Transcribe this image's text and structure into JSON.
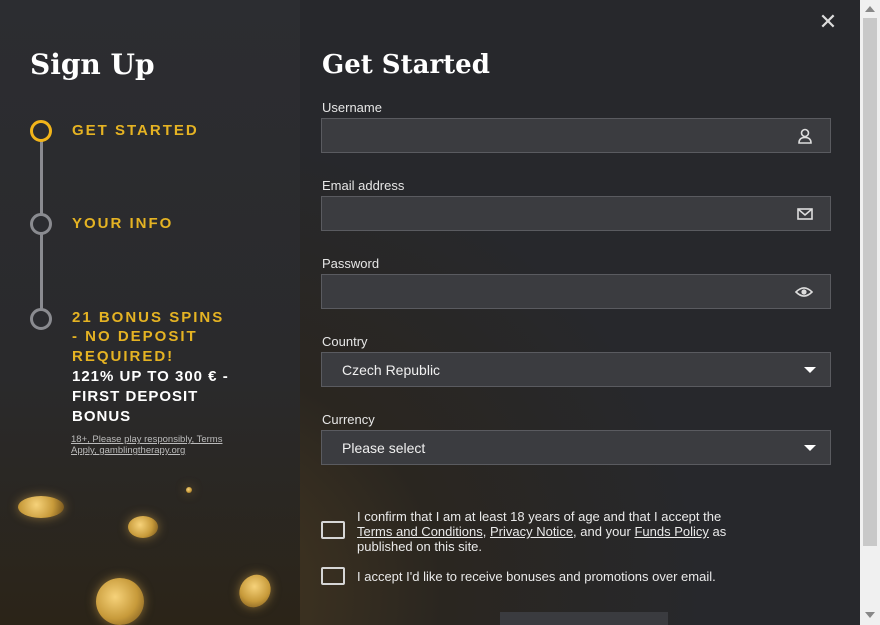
{
  "sidebar": {
    "title": "Sign Up",
    "steps": [
      {
        "label": "GET STARTED",
        "active": true
      },
      {
        "label": "YOUR INFO",
        "active": false
      },
      {
        "label": "21 BONUS SPINS - NO DEPOSIT REQUIRED!",
        "active": false
      }
    ],
    "bonus_lines": [
      "121% UP TO 300 € -",
      "FIRST DEPOSIT",
      "BONUS"
    ],
    "fine_print_lines": [
      "18+, Please play responsibly, Terms",
      "Apply, gamblingtherapy.org"
    ],
    "step3_lines": [
      "21 BONUS SPINS",
      "- NO DEPOSIT",
      "REQUIRED!"
    ]
  },
  "form": {
    "title": "Get Started",
    "username_label": "Username",
    "email_label": "Email address",
    "password_label": "Password",
    "country_label": "Country",
    "country_value": "Czech Republic",
    "currency_label": "Currency",
    "currency_value": "Please select",
    "icons": {
      "username": "user-icon",
      "email": "envelope-icon",
      "password": "eye-icon"
    }
  },
  "consent": {
    "age_text_1": "I confirm that I am at least 18 years of age and that I accept the",
    "terms_link": "Terms and Conditions",
    "sep1": ", ",
    "privacy_link": "Privacy Notice",
    "sep2": ", and your ",
    "funds_link": "Funds Policy",
    "sep3": " as",
    "age_text_3": "published on this site.",
    "marketing_text": "I accept I'd like to receive bonuses and promotions over email."
  },
  "close_glyph": "✕",
  "colors": {
    "accent": "#e5b323",
    "background": "#2b2c30",
    "field": "#3b3c40"
  }
}
